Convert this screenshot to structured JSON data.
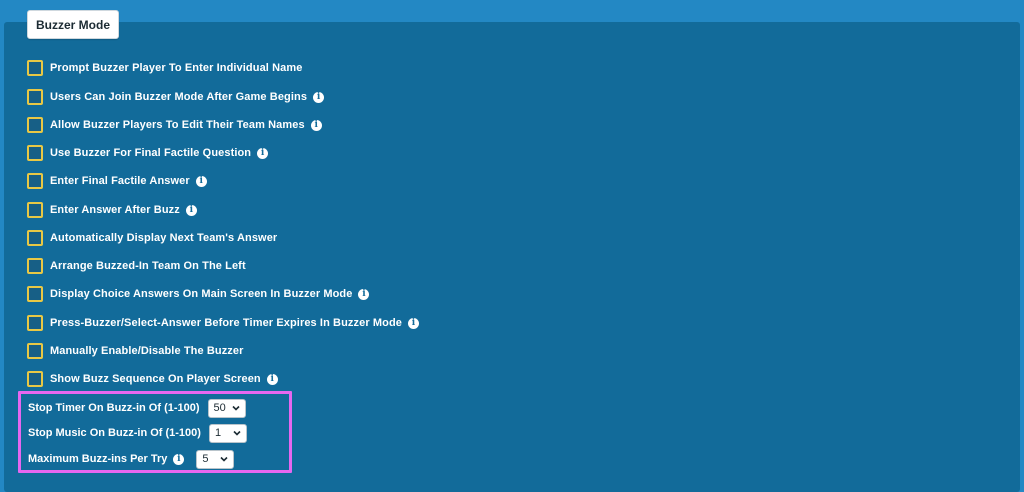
{
  "tab": {
    "label": "Buzzer Mode"
  },
  "options": [
    {
      "label": "Prompt Buzzer Player To Enter Individual Name",
      "info": false,
      "checked": false
    },
    {
      "label": "Users Can Join Buzzer Mode After Game Begins",
      "info": true,
      "checked": false
    },
    {
      "label": "Allow Buzzer Players To Edit Their Team Names",
      "info": true,
      "checked": false
    },
    {
      "label": "Use Buzzer For Final Factile Question",
      "info": true,
      "checked": false
    },
    {
      "label": "Enter Final Factile Answer",
      "info": true,
      "checked": false
    },
    {
      "label": "Enter Answer After Buzz",
      "info": true,
      "checked": false
    },
    {
      "label": "Automatically Display Next Team's Answer",
      "info": false,
      "checked": false
    },
    {
      "label": "Arrange Buzzed-In Team On The Left",
      "info": false,
      "checked": false
    },
    {
      "label": "Display Choice Answers On Main Screen In Buzzer Mode",
      "info": true,
      "checked": false
    },
    {
      "label": "Press-Buzzer/Select-Answer Before Timer Expires In Buzzer Mode",
      "info": true,
      "checked": false
    },
    {
      "label": "Manually Enable/Disable The Buzzer",
      "info": false,
      "checked": false
    },
    {
      "label": "Show Buzz Sequence On Player Screen",
      "info": true,
      "checked": false
    }
  ],
  "settings": [
    {
      "label": "Stop Timer On Buzz-in Of (1-100)",
      "value": "50",
      "info": false
    },
    {
      "label": "Stop Music On Buzz-in Of (1-100)",
      "value": "1",
      "info": false
    },
    {
      "label": "Maximum Buzz-ins Per Try",
      "value": "5",
      "info": true
    }
  ],
  "icons": {
    "info": "info-icon",
    "dropdown": "chevron-down-icon"
  },
  "colors": {
    "panel": "#126b9a",
    "background": "#2388c4",
    "checkbox_border": "#e8c845",
    "highlight": "#e667f0"
  }
}
